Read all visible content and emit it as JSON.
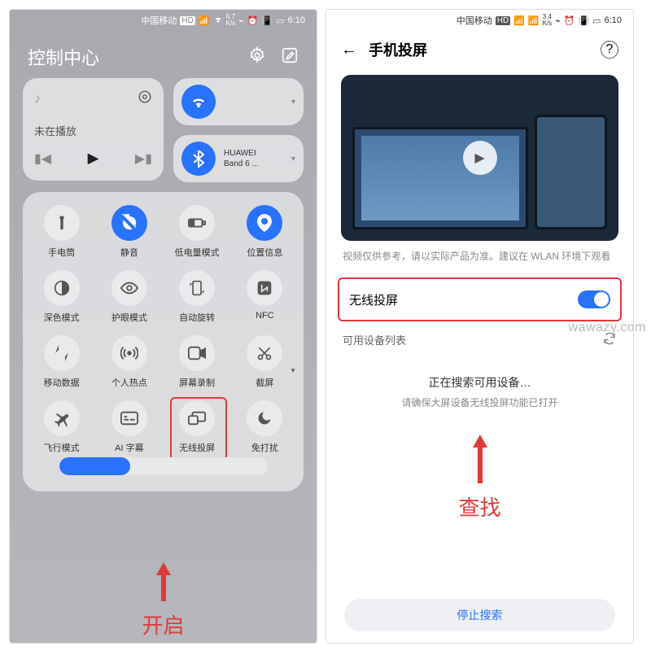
{
  "watermark": "wawazy.com",
  "statusbar": {
    "carrier": "中国移动",
    "badge": "HD",
    "speed_1": "6.7",
    "speed_2": "3.4",
    "unit": "K/s",
    "time": "6:10"
  },
  "control_center": {
    "title": "控制中心",
    "music": {
      "status": "未在播放"
    },
    "bt_device": {
      "line1": "HUAWEI",
      "line2": "Band 6 ..."
    },
    "tiles": {
      "r1": [
        {
          "name": "flashlight",
          "label": "手电筒",
          "on": false
        },
        {
          "name": "mute",
          "label": "静音",
          "on": true
        },
        {
          "name": "low-battery",
          "label": "低电量模式",
          "on": false
        },
        {
          "name": "location",
          "label": "位置信息",
          "on": true
        }
      ],
      "r2": [
        {
          "name": "dark-mode",
          "label": "深色模式",
          "on": false
        },
        {
          "name": "eye-comfort",
          "label": "护眼模式",
          "on": false
        },
        {
          "name": "auto-rotate",
          "label": "自动旋转",
          "on": false
        },
        {
          "name": "nfc",
          "label": "NFC",
          "on": false
        }
      ],
      "r3": [
        {
          "name": "mobile-data",
          "label": "移动数据",
          "on": false
        },
        {
          "name": "hotspot",
          "label": "个人热点",
          "on": false
        },
        {
          "name": "screen-record",
          "label": "屏幕录制",
          "on": false
        },
        {
          "name": "screenshot",
          "label": "截屏",
          "on": false
        }
      ],
      "r4": [
        {
          "name": "airplane",
          "label": "飞行模式",
          "on": false
        },
        {
          "name": "ai-caption",
          "label": "AI 字幕",
          "on": false
        },
        {
          "name": "wireless-proj",
          "label": "无线投屏",
          "on": false
        },
        {
          "name": "dnd",
          "label": "免打扰",
          "on": false
        }
      ]
    },
    "annotation": "开启"
  },
  "cast_page": {
    "title": "手机投屏",
    "video_note": "视频仅供参考，请以实际产品为准。建议在 WLAN 环境下观看",
    "toggle_label": "无线投屏",
    "device_list_label": "可用设备列表",
    "searching": "正在搜索可用设备…",
    "searching_hint": "请确保大屏设备无线投屏功能已打开",
    "annotation": "查找",
    "stop_button": "停止搜索"
  }
}
